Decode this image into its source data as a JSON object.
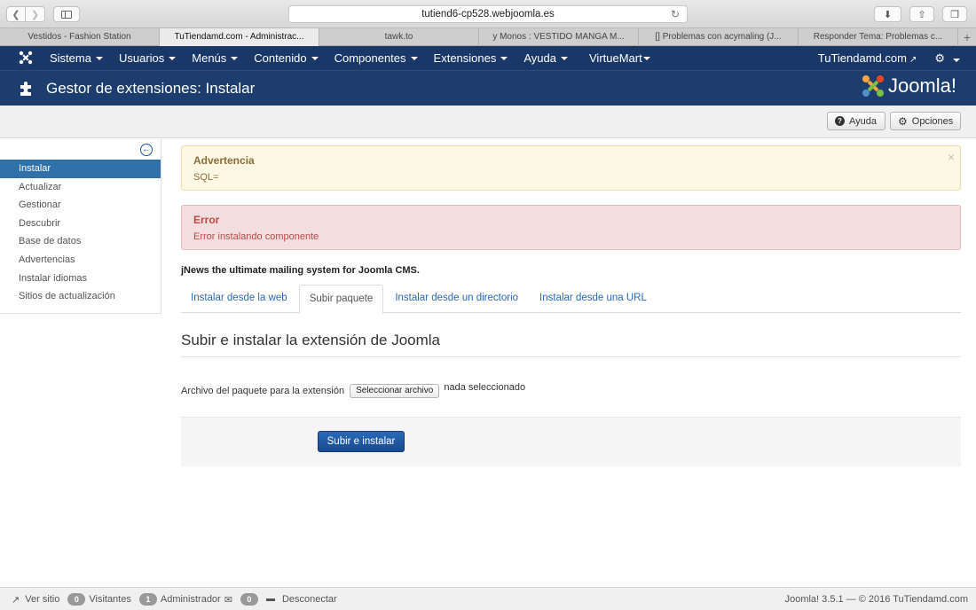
{
  "browser": {
    "url": "tutiend6-cp528.webjoomla.es",
    "tabs": [
      {
        "label": "Vestidos - Fashion Station"
      },
      {
        "label": "TuTiendamd.com - Administrac..."
      },
      {
        "label": "tawk.to"
      },
      {
        "label": "y Monos : VESTIDO MANGA M..."
      },
      {
        "label": "[] Problemas con acymaling (J..."
      },
      {
        "label": "Responder Tema: Problemas c..."
      }
    ]
  },
  "nav": {
    "items": [
      "Sistema",
      "Usuarios",
      "Menús",
      "Contenido",
      "Componentes",
      "Extensiones",
      "Ayuda",
      "VirtueMart"
    ],
    "site_link": "TuTiendamd.com"
  },
  "header": {
    "title": "Gestor de extensiones: Instalar",
    "brand": "Joomla!"
  },
  "toolbar": {
    "help_label": "Ayuda",
    "options_label": "Opciones"
  },
  "sidebar": {
    "items": [
      {
        "label": "Instalar",
        "active": true
      },
      {
        "label": "Actualizar",
        "active": false
      },
      {
        "label": "Gestionar",
        "active": false
      },
      {
        "label": "Descubrir",
        "active": false
      },
      {
        "label": "Base de datos",
        "active": false
      },
      {
        "label": "Advertencias",
        "active": false
      },
      {
        "label": "Instalar idiomas",
        "active": false
      },
      {
        "label": "Sitios de actualización",
        "active": false
      }
    ]
  },
  "alerts": {
    "warning_title": "Advertencia",
    "warning_msg": "SQL=",
    "error_title": "Error",
    "error_msg": "Error instalando componente"
  },
  "main": {
    "extension_note": "jNews the ultimate mailing system for Joomla CMS.",
    "tabs": [
      {
        "label": "Instalar desde la web",
        "active": false
      },
      {
        "label": "Subir paquete",
        "active": true
      },
      {
        "label": "Instalar desde un directorio",
        "active": false
      },
      {
        "label": "Instalar desde una URL",
        "active": false
      }
    ],
    "section_title": "Subir e instalar la extensión de Joomla",
    "file_label": "Archivo del paquete para la extensión",
    "file_button": "Seleccionar archivo",
    "file_status": "nada seleccionado",
    "submit_label": "Subir e instalar"
  },
  "status": {
    "view_site": "Ver sitio",
    "visitors_count": "0",
    "visitors_label": "Visitantes",
    "admin_count": "1",
    "admin_label": "Administrador",
    "messages_count": "0",
    "logout": "Desconectar",
    "version_info": "Joomla! 3.5.1 — © 2016 TuTiendamd.com"
  },
  "colors": {
    "nav_bg": "#1a3867",
    "header_bg": "#1c3d6e",
    "active_sidebar": "#3071a9",
    "warning_bg": "#fcf8e3",
    "error_bg": "#f2dede",
    "primary_button": "#2a69b8"
  }
}
